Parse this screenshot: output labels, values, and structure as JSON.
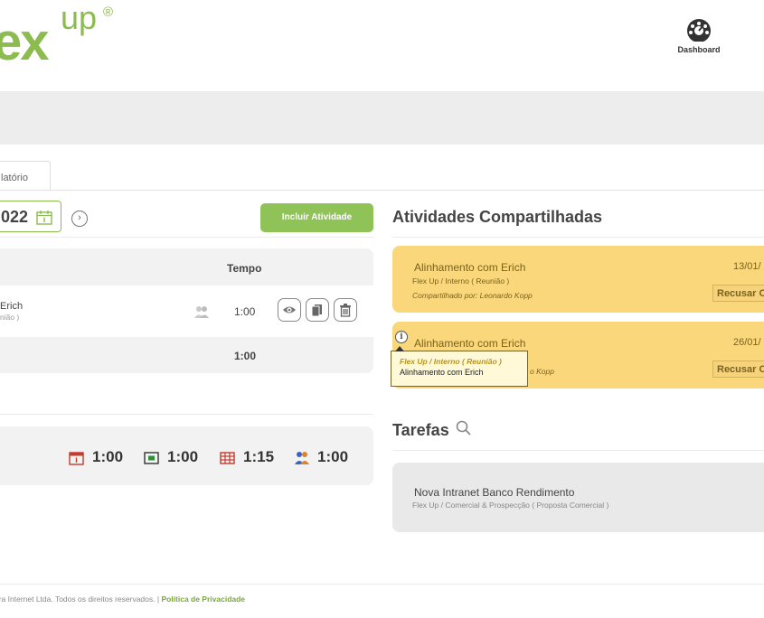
{
  "brand": {
    "logo_main": "ex",
    "logo_sup": "up",
    "logo_reg": "®"
  },
  "header": {
    "dashboard_label": "Dashboard"
  },
  "tabs": [
    {
      "label": "latório"
    }
  ],
  "agenda": {
    "date_text": "022",
    "next_glyph": "›",
    "add_button_label": "Incluir Atividade",
    "column_tempo": "Tempo",
    "rows": [
      {
        "name": "Erich",
        "sub": "nião )",
        "time": "1:00"
      }
    ],
    "total_time": "1:00"
  },
  "summary": [
    {
      "icon": "calendar-icon",
      "value": "1:00",
      "color": "#c43a2e"
    },
    {
      "icon": "screen-icon",
      "value": "1:00",
      "color": "#2f8f3a"
    },
    {
      "icon": "table-icon",
      "value": "1:15",
      "color": "#c43a2e"
    },
    {
      "icon": "people-icon",
      "value": "1:00",
      "color": "#3a64c4"
    }
  ],
  "shared": {
    "title": "Atividades Compartilhadas",
    "items": [
      {
        "title": "Alinhamento com Erich",
        "sub": "Flex Up / Interno ( Reunião )",
        "by": "Compartilhado por: Leonardo Kopp",
        "date": "13/01/",
        "decline_label": "Recusar C"
      },
      {
        "title": "Alinhamento com Erich",
        "sub": "",
        "by": "o Kopp",
        "date": "26/01/",
        "decline_label": "Recusar C"
      }
    ],
    "tooltip": {
      "line1": "Flex Up / Interno ( Reunião )",
      "line2": "Alinhamento com Erich"
    }
  },
  "tasks": {
    "title": "Tarefas",
    "items": [
      {
        "title": "Nova Intranet Banco Rendimento",
        "sub": "Flex Up / Comercial & Prospecção ( Proposta Comercial )"
      }
    ]
  },
  "footer": {
    "text": "ara Internet Ltda. Todos os direitos reservados. | ",
    "link": "Política de Privacidade"
  },
  "colors": {
    "brand_green": "#8cbc4f",
    "card_yellow": "#f9d77a",
    "card_gray": "#f2f2f2"
  }
}
